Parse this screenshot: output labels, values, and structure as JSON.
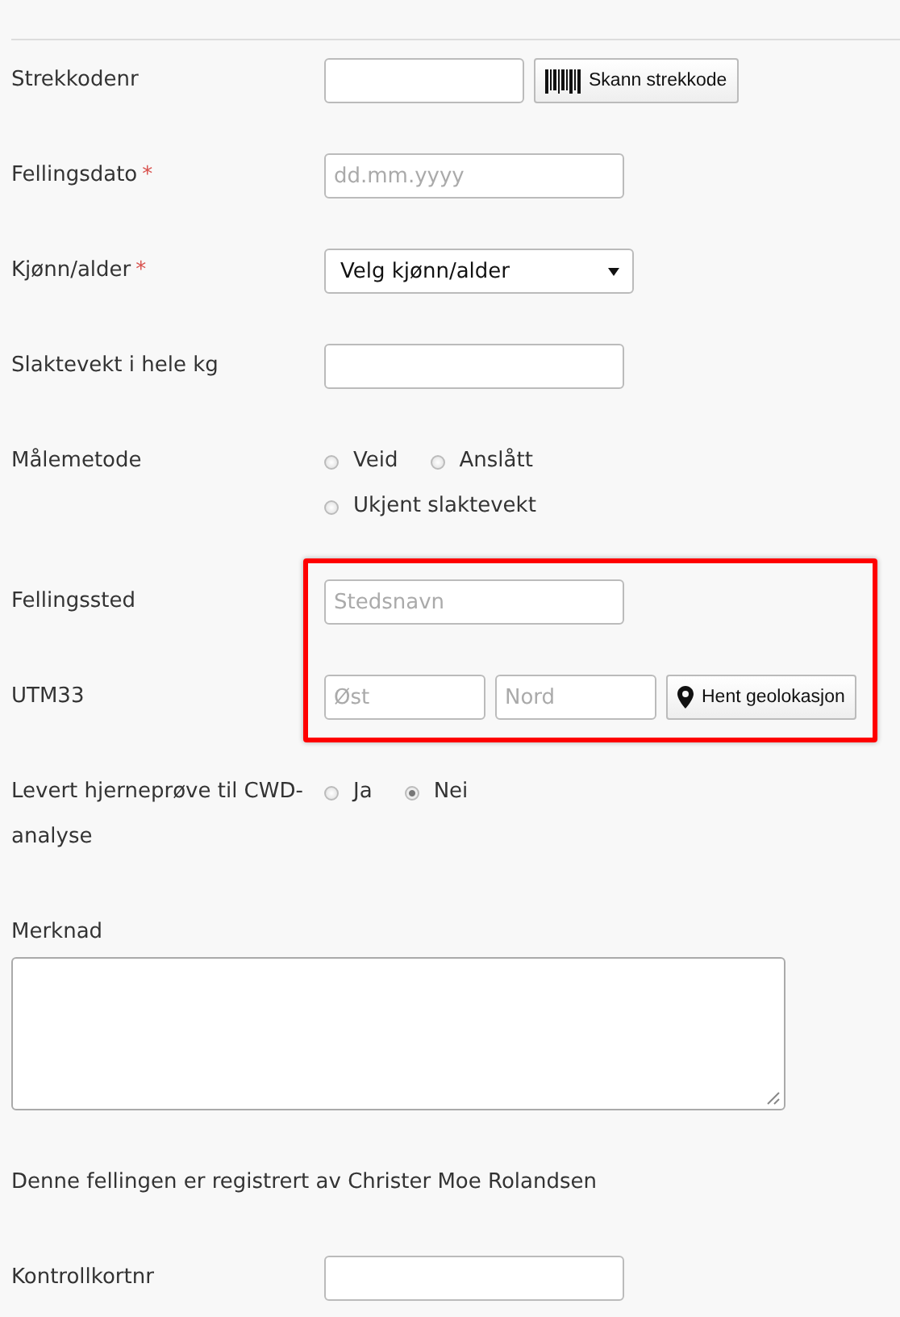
{
  "fields": [
    {
      "kind": "scan",
      "label": "Strekkodenr",
      "highlighted": false,
      "button": "Skann strekkode"
    },
    {
      "kind": "text",
      "label": "Fellingsdato",
      "required_mark": "*",
      "highlighted": false,
      "placeholder": "dd.mm.yyyy"
    },
    {
      "kind": "select",
      "label": "Kjønn/alder",
      "required_mark": "*",
      "highlighted": false,
      "value": "Velg kjønn/alder"
    },
    {
      "kind": "text",
      "label": "Slaktevekt i hele kg",
      "highlighted": false
    },
    {
      "kind": "radio",
      "label": "Målemetode",
      "highlighted": false,
      "options": [
        {
          "label": "Veid",
          "selected": false
        },
        {
          "label": "Anslått",
          "selected": false
        },
        {
          "label": "Ukjent slaktevekt",
          "selected": false
        }
      ]
    },
    {
      "kind": "text",
      "label": "Fellingssted",
      "highlighted": true,
      "placeholder": "Stedsnavn"
    },
    {
      "kind": "geo",
      "label": "UTM33",
      "highlighted": true,
      "placeholders": [
        "Øst",
        "Nord"
      ],
      "button": "Hent geolokasjon"
    },
    {
      "kind": "radio",
      "label": "Levert hjerneprøve til CWD-analyse",
      "highlighted": false,
      "options": [
        {
          "label": "Ja",
          "selected": false
        },
        {
          "label": "Nei",
          "selected": true
        }
      ]
    },
    {
      "kind": "textarea",
      "label": "Merknad",
      "highlighted": false
    },
    {
      "kind": "note",
      "text": "Denne fellingen er registrert av Christer Moe Rolandsen"
    },
    {
      "kind": "text",
      "label": "Kontrollkortnr",
      "highlighted": false
    }
  ]
}
